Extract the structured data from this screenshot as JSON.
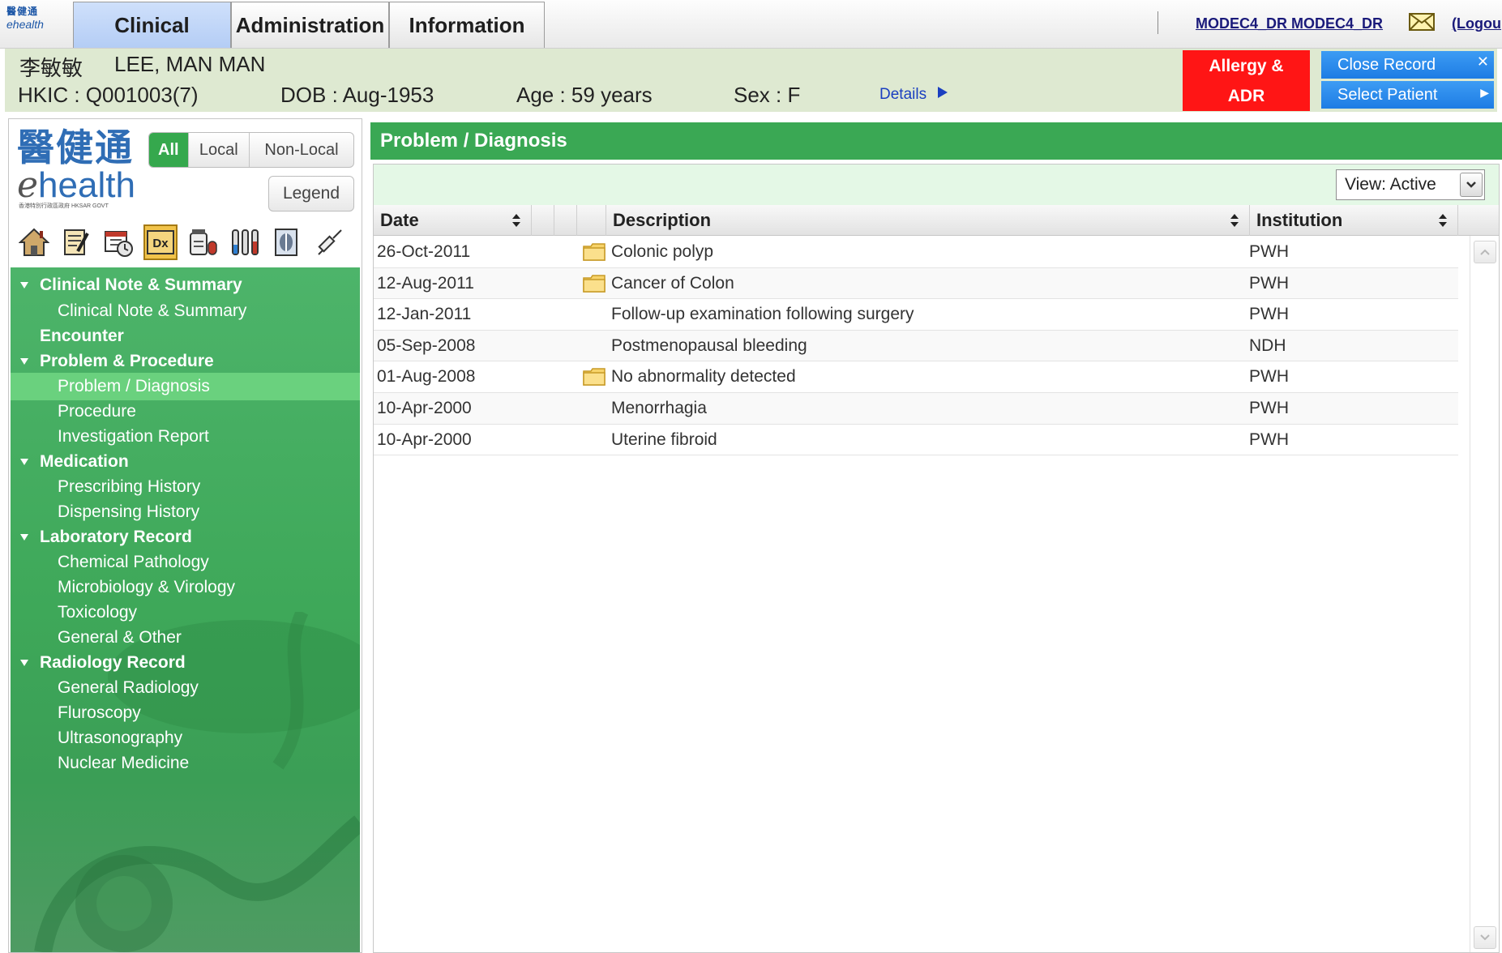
{
  "topbar": {
    "logo": {
      "cn": "醫健通",
      "en": "ehealth"
    },
    "tabs": [
      {
        "label": "Clinical",
        "active": true
      },
      {
        "label": "Administration",
        "active": false
      },
      {
        "label": "Information",
        "active": false
      }
    ],
    "user": "MODEC4_DR MODEC4_DR",
    "logout": "(Logou"
  },
  "patient": {
    "name_cn": "李敏敏",
    "name_en": "LEE, MAN MAN",
    "hkic": "HKIC : Q001003(7)",
    "dob": "DOB : Aug-1953",
    "age": "Age : 59 years",
    "sex": "Sex : F",
    "details_link": "Details"
  },
  "actions": {
    "allergy_line1": "Allergy &",
    "allergy_line2": "ADR",
    "close_record": "Close Record",
    "select_patient": "Select Patient",
    "colors": {
      "allergy": "#ff1515",
      "blue": "#2b8ceb"
    }
  },
  "sidebar": {
    "logo_cn": "醫健通",
    "logo_e": "e",
    "logo_rest": "health",
    "logo_sub": "香港特別行政區政府 HKSAR GOVT",
    "filters": [
      "All",
      "Local",
      "Non-Local"
    ],
    "selected_filter": "All",
    "legend": "Legend",
    "tools": [
      "home-icon",
      "clinical-note-icon",
      "calendar-icon",
      "dx-icon",
      "medication-icon",
      "laboratory-icon",
      "radiology-icon",
      "injection-icon"
    ],
    "nav": [
      {
        "label": "Clinical Note & Summary",
        "kind": "group"
      },
      {
        "label": "Clinical Note & Summary",
        "kind": "sub"
      },
      {
        "label": "Encounter",
        "kind": "plain"
      },
      {
        "label": "Problem & Procedure",
        "kind": "group"
      },
      {
        "label": "Problem / Diagnosis",
        "kind": "sub",
        "selected": true
      },
      {
        "label": "Procedure",
        "kind": "sub"
      },
      {
        "label": "Investigation Report",
        "kind": "sub"
      },
      {
        "label": "Medication",
        "kind": "group"
      },
      {
        "label": "Prescribing History",
        "kind": "sub"
      },
      {
        "label": "Dispensing History",
        "kind": "sub"
      },
      {
        "label": "Laboratory Record",
        "kind": "group"
      },
      {
        "label": "Chemical Pathology",
        "kind": "sub"
      },
      {
        "label": "Microbiology & Virology",
        "kind": "sub"
      },
      {
        "label": "Toxicology",
        "kind": "sub"
      },
      {
        "label": "General & Other",
        "kind": "sub"
      },
      {
        "label": "Radiology Record",
        "kind": "group"
      },
      {
        "label": "General Radiology",
        "kind": "sub"
      },
      {
        "label": "Fluroscopy",
        "kind": "sub"
      },
      {
        "label": "Ultrasonography",
        "kind": "sub"
      },
      {
        "label": "Nuclear Medicine",
        "kind": "sub"
      }
    ]
  },
  "main": {
    "title": "Problem / Diagnosis",
    "view_select": "View: Active",
    "columns": {
      "date": "Date",
      "description": "Description",
      "institution": "Institution"
    },
    "rows": [
      {
        "date": "26-Oct-2011",
        "folder": true,
        "description": "Colonic polyp",
        "institution": "PWH"
      },
      {
        "date": "12-Aug-2011",
        "folder": true,
        "description": "Cancer of Colon",
        "institution": "PWH"
      },
      {
        "date": "12-Jan-2011",
        "folder": false,
        "description": "Follow-up examination following surgery",
        "institution": "PWH"
      },
      {
        "date": "05-Sep-2008",
        "folder": false,
        "description": "Postmenopausal bleeding",
        "institution": "NDH"
      },
      {
        "date": "01-Aug-2008",
        "folder": true,
        "description": "No abnormality detected",
        "institution": "PWH"
      },
      {
        "date": "10-Apr-2000",
        "folder": false,
        "description": "Menorrhagia",
        "institution": "PWH"
      },
      {
        "date": "10-Apr-2000",
        "folder": false,
        "description": "Uterine fibroid",
        "institution": "PWH"
      }
    ]
  }
}
